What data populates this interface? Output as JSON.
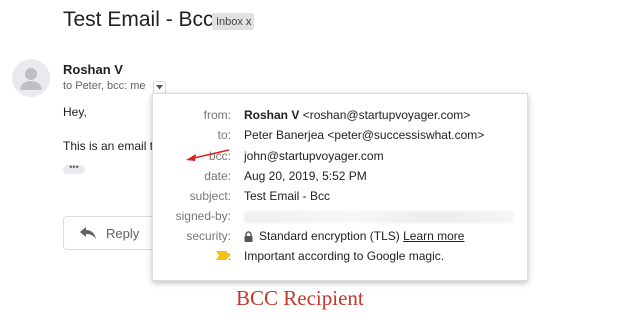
{
  "email": {
    "subject": "Test Email - Bcc",
    "label_chip": "Inbox",
    "label_remove": "x",
    "sender_name": "Roshan V",
    "to_summary": "to Peter, bcc: me",
    "greeting": "Hey,",
    "body_text": "This is an email t",
    "ellipsis": "•••",
    "reply_label": "Reply"
  },
  "details": {
    "rows": [
      {
        "label": "from:",
        "name": "Roshan V",
        "value": "<roshan@startupvoyager.com>"
      },
      {
        "label": "to:",
        "value": "Peter Banerjea <peter@successiswhat.com>"
      },
      {
        "label": "bcc:",
        "value": "john@startupvoyager.com"
      },
      {
        "label": "date:",
        "value": "Aug 20, 2019, 5:52 PM"
      },
      {
        "label": "subject:",
        "value": "Test Email - Bcc"
      },
      {
        "label": "signed-by:",
        "value": ""
      },
      {
        "label": "security:",
        "value": "Standard encryption (TLS)",
        "link": "Learn more"
      },
      {
        "label": ":",
        "value": "Important according to Google magic."
      }
    ]
  },
  "annotation": {
    "caption": "BCC Recipient",
    "arrow_color": "#e02020",
    "caption_color": "#c0392b"
  },
  "colors": {
    "importance_marker": "#f4c20d"
  }
}
